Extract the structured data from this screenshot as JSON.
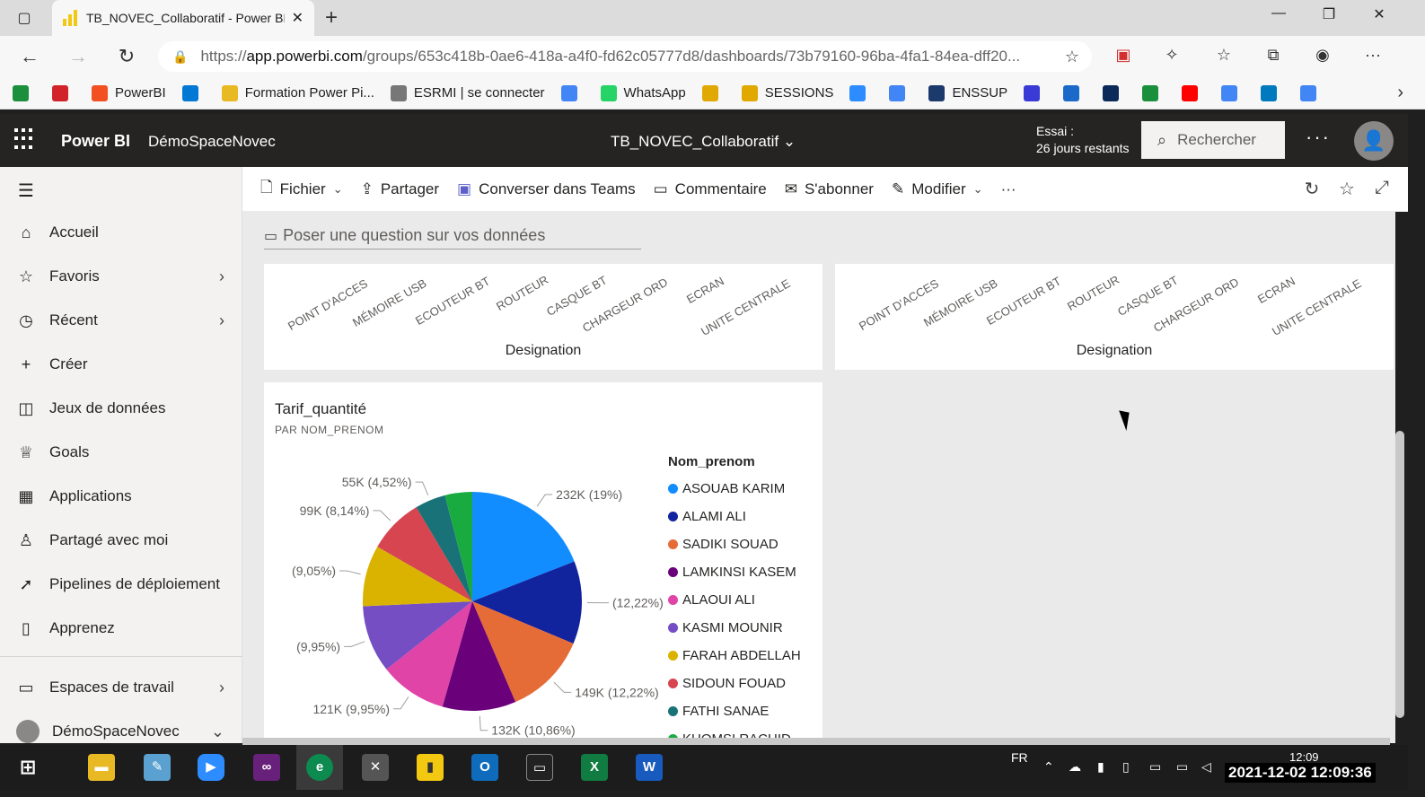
{
  "browser": {
    "tab_title": "TB_NOVEC_Collaboratif - Power BI",
    "url_prefix": "https://",
    "url_host": "app.powerbi.com",
    "url_path": "/groups/653c418b-0ae6-418a-a4f0-fd62c05777d8/dashboards/73b79160-96ba-4fa1-84ea-dff20...",
    "bookmarks": [
      {
        "label": "",
        "icon": "gmail-icon",
        "color": "#1a8f3c"
      },
      {
        "label": "",
        "icon": "opera-icon",
        "color": "#d2232a"
      },
      {
        "label": "PowerBI",
        "icon": "microsoft-icon",
        "color": "#f25022"
      },
      {
        "label": "",
        "icon": "azure-icon",
        "color": "#0078d4"
      },
      {
        "label": "Formation Power Pi...",
        "icon": "folder-icon",
        "color": "#e8b923"
      },
      {
        "label": "ESRMI | se connecter",
        "icon": "esrmi-icon",
        "color": "#777777"
      },
      {
        "label": "",
        "icon": "google-icon",
        "color": "#4285f4"
      },
      {
        "label": "WhatsApp",
        "icon": "whatsapp-icon",
        "color": "#25d366"
      },
      {
        "label": "",
        "icon": "star-burst-icon",
        "color": "#e0a800"
      },
      {
        "label": "SESSIONS",
        "icon": "star-burst-icon",
        "color": "#e0a800"
      },
      {
        "label": "",
        "icon": "zoom-icon",
        "color": "#2d8cff"
      },
      {
        "label": "",
        "icon": "google-icon",
        "color": "#4285f4"
      },
      {
        "label": "ENSSUP",
        "icon": "enssup-icon",
        "color": "#1b3a6b"
      },
      {
        "label": "",
        "icon": "app-icon",
        "color": "#3a3ad6"
      },
      {
        "label": "",
        "icon": "plus-icon",
        "color": "#1b6ac9"
      },
      {
        "label": "",
        "icon": "two-icon",
        "color": "#0b2a5a"
      },
      {
        "label": "",
        "icon": "flag-icon",
        "color": "#1a8f3c"
      },
      {
        "label": "",
        "icon": "youtube-icon",
        "color": "#ff0000"
      },
      {
        "label": "",
        "icon": "google-icon",
        "color": "#4285f4"
      },
      {
        "label": "",
        "icon": "trello-icon",
        "color": "#0079bf"
      },
      {
        "label": "",
        "icon": "google-icon",
        "color": "#4285f4"
      }
    ]
  },
  "header": {
    "brand": "Power BI",
    "workspace": "DémoSpaceNovec",
    "dashboard_title": "TB_NOVEC_Collaboratif",
    "trial_line1": "Essai :",
    "trial_line2": "26 jours restants",
    "search_placeholder": "Rechercher"
  },
  "nav": {
    "items": [
      {
        "label": "Accueil",
        "icon": "home-icon",
        "chevron": false
      },
      {
        "label": "Favoris",
        "icon": "star-icon",
        "chevron": true
      },
      {
        "label": "Récent",
        "icon": "clock-icon",
        "chevron": true
      },
      {
        "label": "Créer",
        "icon": "plus-icon",
        "chevron": false
      },
      {
        "label": "Jeux de données",
        "icon": "database-icon",
        "chevron": false
      },
      {
        "label": "Goals",
        "icon": "trophy-icon",
        "chevron": false
      },
      {
        "label": "Applications",
        "icon": "apps-icon",
        "chevron": false
      },
      {
        "label": "Partagé avec moi",
        "icon": "shared-icon",
        "chevron": false
      },
      {
        "label": "Pipelines de déploiement",
        "icon": "rocket-icon",
        "chevron": false
      },
      {
        "label": "Apprenez",
        "icon": "book-icon",
        "chevron": false
      }
    ],
    "workspaces_label": "Espaces de travail",
    "current_workspace": "DémoSpaceNovec"
  },
  "actionbar": {
    "fichier": "Fichier",
    "partager": "Partager",
    "teams": "Converser dans Teams",
    "commentaire": "Commentaire",
    "abonner": "S'abonner",
    "modifier": "Modifier",
    "more": "···"
  },
  "content": {
    "qa_placeholder": "Poser une question sur vos données",
    "axis_categories": [
      "POINT D'ACCES",
      "MÉMOIRE USB",
      "ECOUTEUR BT",
      "ROUTEUR",
      "CASQUE BT",
      "CHARGEUR ORD",
      "ECRAN",
      "UNITE CENTRALE"
    ],
    "axis_title": "Designation",
    "pie_tile": {
      "title": "Tarif_quantité",
      "subtitle": "PAR NOM_PRENOM",
      "legend_title": "Nom_prenom"
    }
  },
  "chart_data": {
    "type": "pie",
    "title": "Tarif_quantité",
    "subtitle": "PAR NOM_PRENOM",
    "legend_title": "Nom_prenom",
    "slices": [
      {
        "name": "ASOUAB KARIM",
        "value": 232,
        "label": "232K (19%)",
        "color": "#118dff"
      },
      {
        "name": "ALAMI ALI",
        "value": 149,
        "label": "(12,22%)",
        "color": "#12239e"
      },
      {
        "name": "SADIKI SOUAD",
        "value": 149,
        "label": "149K (12,22%)",
        "color": "#e66c37"
      },
      {
        "name": "LAMKINSI KASEM",
        "value": 132,
        "label": "132K (10,86%)",
        "color": "#6b007b"
      },
      {
        "name": "ALAOUI ALI",
        "value": 121,
        "label": "121K (9,95%)",
        "color": "#e044a7"
      },
      {
        "name": "KASMI MOUNIR",
        "value": 121,
        "label": "(9,95%)",
        "color": "#744ec2"
      },
      {
        "name": "FARAH ABDELLAH",
        "value": 110,
        "label": "(9,05%)",
        "color": "#d9b300"
      },
      {
        "name": "SIDOUN FOUAD",
        "value": 99,
        "label": "99K (8,14%)",
        "color": "#d64550"
      },
      {
        "name": "FATHI SANAE",
        "value": 55,
        "label": "55K (4,52%)",
        "color": "#197278"
      },
      {
        "name": "KHOMSI RACHID",
        "value": 49,
        "label": "",
        "color": "#1aab40"
      }
    ]
  },
  "taskbar": {
    "language": "FR",
    "time_small": "12:09",
    "datetime": "2021-12-02 12:09:36"
  }
}
